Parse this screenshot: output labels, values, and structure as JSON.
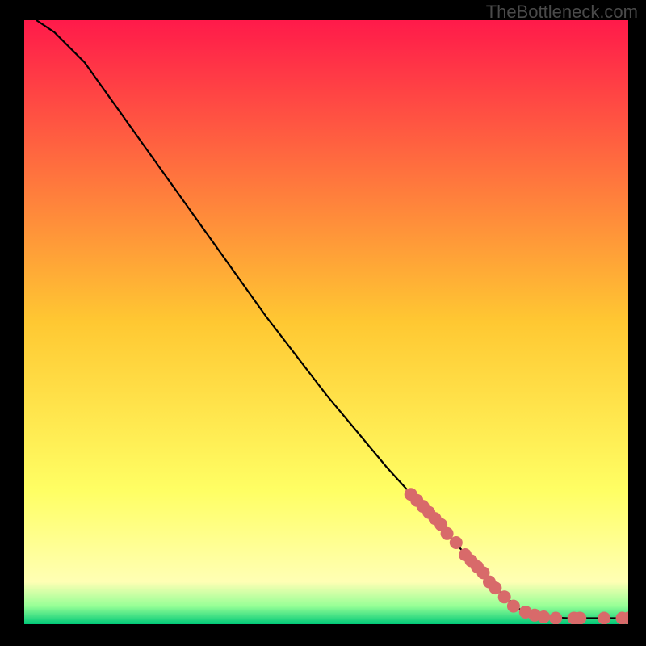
{
  "watermark": "TheBottleneck.com",
  "chart_data": {
    "type": "line",
    "title": "",
    "xlabel": "",
    "ylabel": "",
    "xlim": [
      0,
      100
    ],
    "ylim": [
      0,
      100
    ],
    "grid": false,
    "legend": null,
    "background_gradient": {
      "stops": [
        {
          "offset": 0.0,
          "color": "#ff1a4a"
        },
        {
          "offset": 0.5,
          "color": "#ffc832"
        },
        {
          "offset": 0.78,
          "color": "#ffff64"
        },
        {
          "offset": 0.93,
          "color": "#ffffb4"
        },
        {
          "offset": 0.97,
          "color": "#96ff96"
        },
        {
          "offset": 1.0,
          "color": "#00c878"
        }
      ]
    },
    "curve": [
      {
        "x": 2,
        "y": 100
      },
      {
        "x": 5,
        "y": 98
      },
      {
        "x": 10,
        "y": 93
      },
      {
        "x": 15,
        "y": 86
      },
      {
        "x": 20,
        "y": 79
      },
      {
        "x": 30,
        "y": 65
      },
      {
        "x": 40,
        "y": 51
      },
      {
        "x": 50,
        "y": 38
      },
      {
        "x": 60,
        "y": 26
      },
      {
        "x": 70,
        "y": 15
      },
      {
        "x": 78,
        "y": 6
      },
      {
        "x": 82,
        "y": 2.5
      },
      {
        "x": 86,
        "y": 1.2
      },
      {
        "x": 90,
        "y": 1.0
      },
      {
        "x": 95,
        "y": 1.0
      },
      {
        "x": 100,
        "y": 1.0
      }
    ],
    "markers": [
      {
        "x": 64,
        "y": 21.5
      },
      {
        "x": 65,
        "y": 20.5
      },
      {
        "x": 66,
        "y": 19.5
      },
      {
        "x": 67,
        "y": 18.5
      },
      {
        "x": 68,
        "y": 17.5
      },
      {
        "x": 69,
        "y": 16.5
      },
      {
        "x": 70,
        "y": 15.0
      },
      {
        "x": 71.5,
        "y": 13.5
      },
      {
        "x": 73,
        "y": 11.5
      },
      {
        "x": 74,
        "y": 10.5
      },
      {
        "x": 75,
        "y": 9.5
      },
      {
        "x": 76,
        "y": 8.5
      },
      {
        "x": 77,
        "y": 7.0
      },
      {
        "x": 78,
        "y": 6.0
      },
      {
        "x": 79.5,
        "y": 4.5
      },
      {
        "x": 81,
        "y": 3.0
      },
      {
        "x": 83,
        "y": 2.0
      },
      {
        "x": 84.5,
        "y": 1.5
      },
      {
        "x": 86,
        "y": 1.2
      },
      {
        "x": 88,
        "y": 1.0
      },
      {
        "x": 91,
        "y": 1.0
      },
      {
        "x": 92,
        "y": 1.0
      },
      {
        "x": 96,
        "y": 1.0
      },
      {
        "x": 99,
        "y": 1.0
      },
      {
        "x": 100,
        "y": 1.0
      }
    ],
    "marker_style": {
      "color": "#d86a6a",
      "radius": 8
    }
  }
}
